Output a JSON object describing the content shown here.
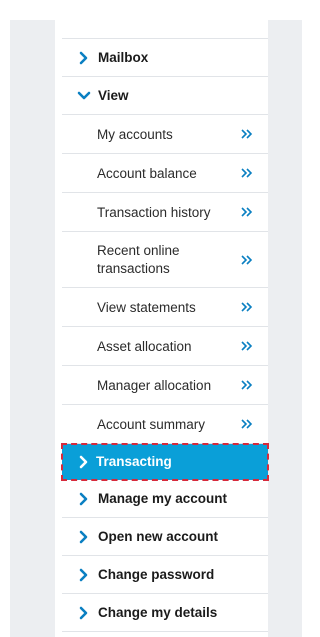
{
  "menu": {
    "mailbox": "Mailbox",
    "view": "View",
    "view_items": [
      "My accounts",
      "Account balance",
      "Transaction history",
      "Recent online transactions",
      "View statements",
      "Asset allocation",
      "Manager allocation",
      "Account summary"
    ],
    "transacting": "Transacting",
    "manage_account": "Manage my account",
    "open_account": "Open new account",
    "change_password": "Change password",
    "change_details": "Change my details"
  },
  "colors": {
    "accent": "#0a9fd8",
    "icon": "#0a7fc2",
    "highlight_outline": "#d62a3c"
  }
}
